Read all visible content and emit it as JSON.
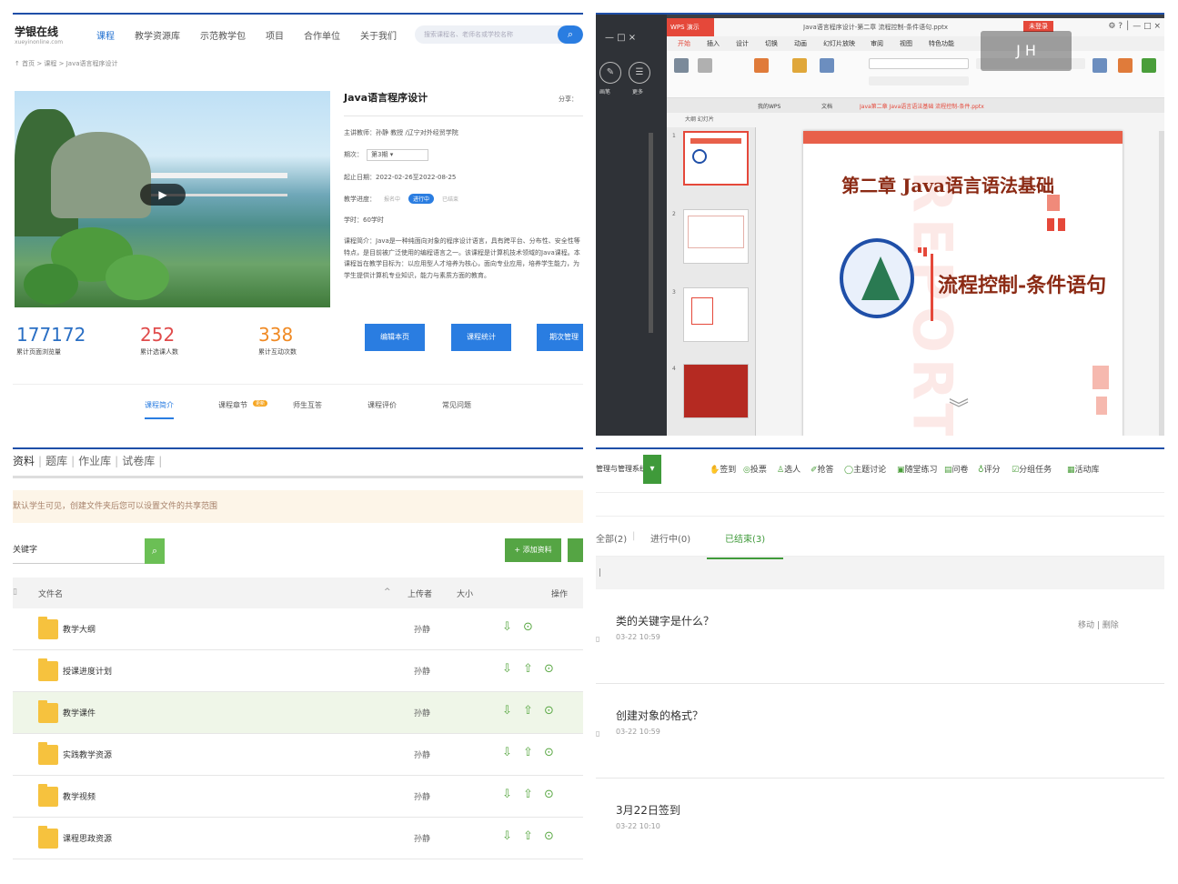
{
  "course_page": {
    "logo_title": "学银在线",
    "logo_sub": "xueyinonline.com",
    "nav": [
      "课程",
      "教学资源库",
      "示范教学包",
      "项目",
      "合作单位",
      "关于我们"
    ],
    "search_placeholder": "搜索课程名、老师名或学校名称",
    "breadcrumb": "↑ 首页 > 课程 > Java语言程序设计",
    "course_title": "Java语言程序设计",
    "share": "分享：",
    "teacher": "主讲教师：孙静 教授 /辽宁对外经贸学院",
    "term_label": "期次：",
    "term_value": "第3期",
    "period": "起止日期：2022-02-26至2022-08-25",
    "progress_label": "教学进度：",
    "progress_states": [
      "报名中",
      "进行中",
      "已结束"
    ],
    "credit": "学时：60学时",
    "intro": "课程简介：Java是一种纯面向对象的程序设计语言，具有跨平台、分布性、安全性等特点，是目前被广泛使用的编程语言之一。该课程是计算机技术领域的Java课程。本课程旨在教学目标为：以应用型人才培养为核心，面向专业应用，培养学生能力，为学生提供计算机专业知识，能力与素质方面的教育。",
    "stats": [
      {
        "value": "177172",
        "label": "累计页面浏览量",
        "color": "#2a6fc4"
      },
      {
        "value": "252",
        "label": "累计选课人数",
        "color": "#e04b4b"
      },
      {
        "value": "338",
        "label": "累计互动次数",
        "color": "#f08a24"
      }
    ],
    "actions": [
      "编辑本页",
      "课程统计",
      "期次管理"
    ],
    "tabs": [
      "课程简介",
      "课程章节",
      "师生互答",
      "课程评价",
      "常见问题"
    ],
    "chapter_badge": "更新"
  },
  "wps": {
    "app": "WPS 演示",
    "doc_title": "Java语言程序设计-第二章 流程控制-条件语句.pptx",
    "sign_in": "未登录",
    "menus": [
      "开始",
      "插入",
      "设计",
      "切换",
      "动画",
      "幻灯片放映",
      "审阅",
      "视图",
      "特色功能"
    ],
    "doc_tabs": [
      "我的WPS",
      "文档",
      "Java第二章 Java语言语法基础 流程控制-条件.pptx"
    ],
    "left_icons": [
      "✎",
      "☰"
    ],
    "left_caps": [
      "画笔",
      "更多"
    ],
    "thumb_label": "大纲  幻灯片",
    "slide_chapter": "第二章  Java语言语法基础",
    "slide_subtitle": "流程控制-条件语句",
    "watermark": "REPORT",
    "overlay": "J  H"
  },
  "resources": {
    "tabs": [
      "资料",
      "题库",
      "作业库",
      "试卷库"
    ],
    "notice": "默认学生可见，创建文件夹后您可以设置文件的共享范围",
    "search_placeholder": "关键字",
    "add_button": "+ 添加资料",
    "headers": [
      "文件名",
      "上传者",
      "大小",
      "操作"
    ],
    "rows": [
      {
        "name": "教学大纲",
        "uploader": "孙静",
        "ops": "⇩ ⊙"
      },
      {
        "name": "授课进度计划",
        "uploader": "孙静",
        "ops": "⇩ ⇧ ⊙"
      },
      {
        "name": "教学课件",
        "uploader": "孙静",
        "ops": "⇩ ⇧ ⊙"
      },
      {
        "name": "实践教学资源",
        "uploader": "孙静",
        "ops": "⇩ ⇧ ⊙"
      },
      {
        "name": "教学视频",
        "uploader": "孙静",
        "ops": "⇩ ⇧ ⊙"
      },
      {
        "name": "课程思政资源",
        "uploader": "孙静",
        "ops": "⇩ ⇧ ⊙"
      }
    ]
  },
  "activities": {
    "class_select": "管理与管理系统...",
    "tools": [
      "签到",
      "投票",
      "选人",
      "抢答",
      "主题讨论",
      "随堂练习",
      "问卷",
      "评分",
      "分组任务",
      "活动库"
    ],
    "status_tabs": [
      "全部(2)",
      "进行中(0)",
      "已结束(3)"
    ],
    "items": [
      {
        "title": "类的关键字是什么？",
        "time": "03-22 10:59",
        "actions": "移动  |  删除"
      },
      {
        "title": "创建对象的格式？",
        "time": "03-22 10:59"
      },
      {
        "title": "3月22日签到",
        "time": "03-22 10:10"
      }
    ]
  }
}
